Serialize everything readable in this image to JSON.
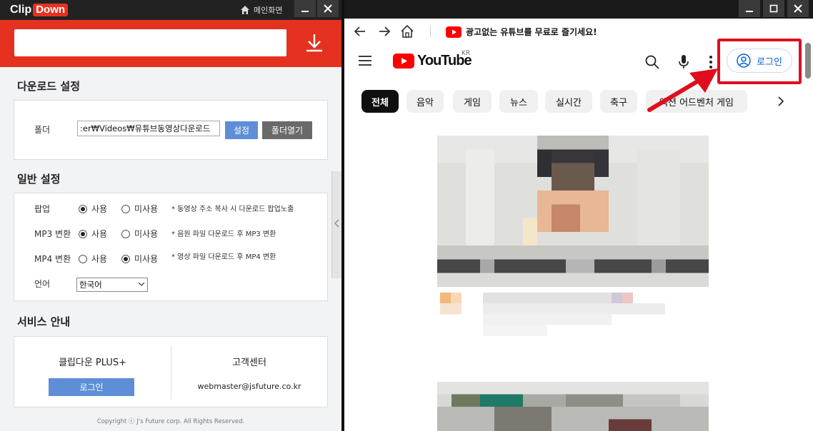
{
  "left_app": {
    "logo_clip": "Clip",
    "logo_down": "Down",
    "home_label": "메인화면",
    "url_input_value": "",
    "download_settings": {
      "title": "다운로드 설정",
      "folder_label": "폴더",
      "folder_path": ":er₩Videos₩유튜브동영상다운로드",
      "set_button": "설정",
      "open_folder_button": "폴더열기"
    },
    "general_settings": {
      "title": "일반 설정",
      "rows": [
        {
          "label": "팝업",
          "opt_use": "사용",
          "opt_unuse": "미사용",
          "selected": "use",
          "note": "* 동영상 주소 복사 시 다운로드 팝업노출"
        },
        {
          "label": "MP3 변환",
          "opt_use": "사용",
          "opt_unuse": "미사용",
          "selected": "use",
          "note": "* 음원 파일 다운로드 후 MP3 변환"
        },
        {
          "label": "MP4 변환",
          "opt_use": "사용",
          "opt_unuse": "미사용",
          "selected": "unuse",
          "note": "* 영상 파일 다운로드 후 MP4 변환"
        }
      ],
      "language_label": "언어",
      "language_value": "한국어"
    },
    "service": {
      "title": "서비스 안내",
      "plus_title": "클립다운 PLUS+",
      "login_button": "로그인",
      "cs_title": "고객센터",
      "cs_email": "webmaster@jsfuture.co.kr"
    },
    "copyright": "Copyright ⓒ J's Future corp. All Rights Reserved."
  },
  "browser": {
    "banner_text": "광고없는 유튜브를 무료로 즐기세요!",
    "youtube_wordmark": "YouTube",
    "region": "KR",
    "login_button": "로그인",
    "chips": [
      "전체",
      "음악",
      "게임",
      "뉴스",
      "실시간",
      "축구",
      "액션 어드벤처 게임"
    ]
  },
  "colors": {
    "clipdown_red": "#e53220",
    "button_blue": "#5e8fd6",
    "youtube_red": "#ff0000",
    "login_blue": "#065fd4",
    "highlight_red": "#e00d1f"
  }
}
